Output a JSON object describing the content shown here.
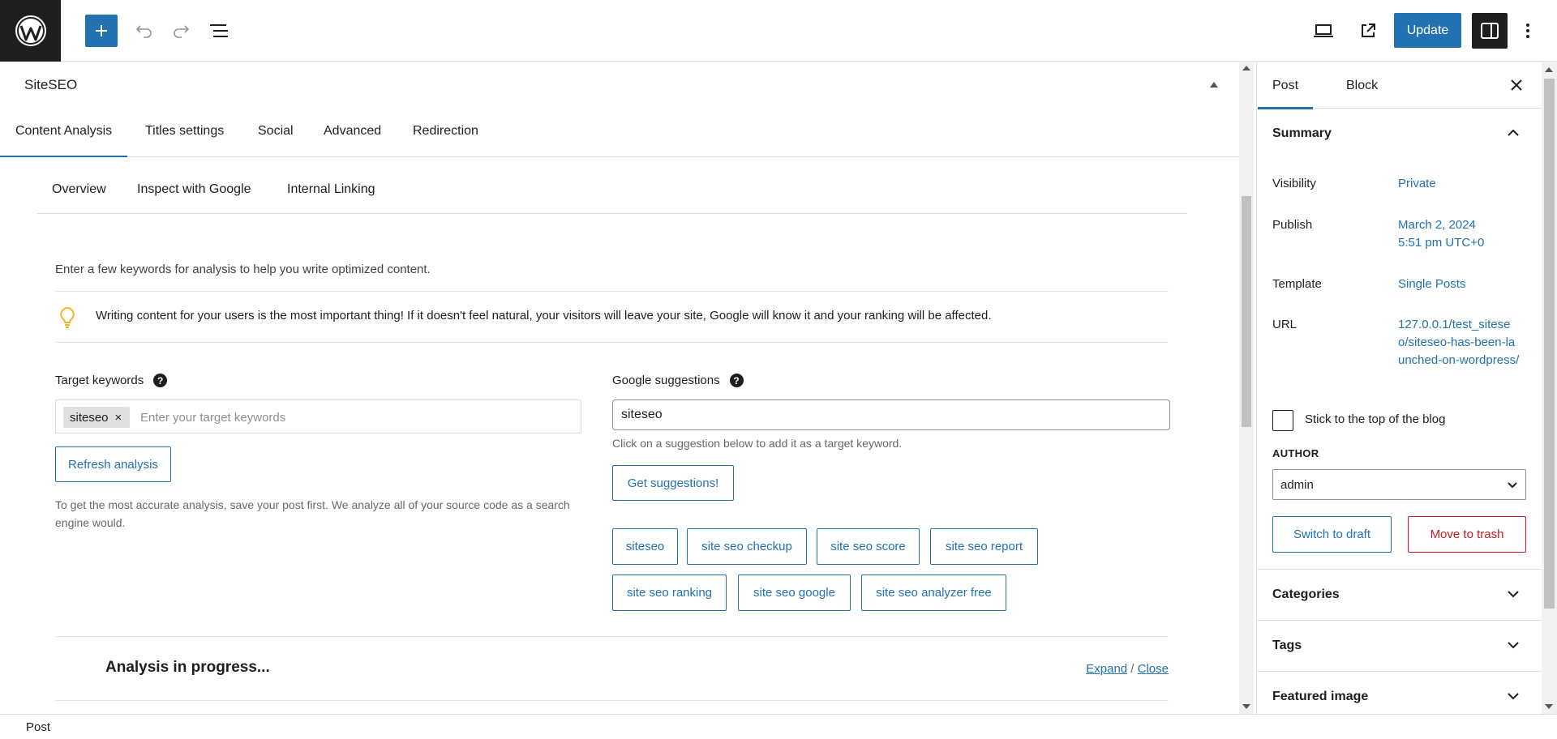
{
  "toolbar": {
    "update_label": "Update"
  },
  "seo_panel": {
    "title": "SiteSEO",
    "tabs": [
      "Content Analysis",
      "Titles settings",
      "Social",
      "Advanced",
      "Redirection"
    ],
    "subtabs": [
      "Overview",
      "Inspect with Google",
      "Internal Linking"
    ],
    "intro": "Enter a few keywords for analysis to help you write optimized content.",
    "tip": "Writing content for your users is the most important thing! If it doesn't feel natural, your visitors will leave your site, Google will know it and your ranking will be affected.",
    "target_keywords": {
      "label": "Target keywords",
      "chip": "siteseo",
      "chip_remove": "×",
      "placeholder": "Enter your target keywords",
      "refresh_label": "Refresh analysis",
      "hint": "To get the most accurate analysis, save your post first. We analyze all of your source code as a search engine would."
    },
    "google_suggestions": {
      "label": "Google suggestions",
      "value": "siteseo",
      "hint": "Click on a suggestion below to add it as a target keyword.",
      "button": "Get suggestions!",
      "suggestions": [
        "siteseo",
        "site seo checkup",
        "site seo score",
        "site seo report",
        "site seo ranking",
        "site seo google",
        "site seo analyzer free"
      ]
    },
    "analysis": {
      "title": "Analysis in progress...",
      "expand": "Expand",
      "separator": "/",
      "close": "Close"
    },
    "help_glyph": "?"
  },
  "sidebar": {
    "tabs": [
      "Post",
      "Block"
    ],
    "summary": {
      "title": "Summary",
      "visibility_label": "Visibility",
      "visibility_value": "Private",
      "publish_label": "Publish",
      "publish_value_1": "March 2, 2024",
      "publish_value_2": "5:51 pm UTC+0",
      "template_label": "Template",
      "template_value": "Single Posts",
      "url_label": "URL",
      "url_value": "127.0.0.1/test_siteseo/siteseo-has-been-launched-on-wordpress/",
      "stick_label": "Stick to the top of the blog",
      "author_label": "AUTHOR",
      "author_value": "admin",
      "draft_label": "Switch to draft",
      "trash_label": "Move to trash"
    },
    "sections": [
      "Categories",
      "Tags",
      "Featured image"
    ]
  },
  "footer": {
    "breadcrumb": "Post"
  },
  "colors": {
    "accent": "#2271b1",
    "danger": "#cc1818",
    "dark": "#1e1e1e"
  },
  "icons": [
    "wordpress-logo-icon",
    "plus-icon",
    "undo-icon",
    "redo-icon",
    "list-view-icon",
    "desktop-view-icon",
    "external-link-icon",
    "sidebar-toggle-icon",
    "more-vertical-icon",
    "lightbulb-icon",
    "help-icon",
    "close-icon",
    "chevron-up-icon",
    "chevron-down-icon"
  ]
}
